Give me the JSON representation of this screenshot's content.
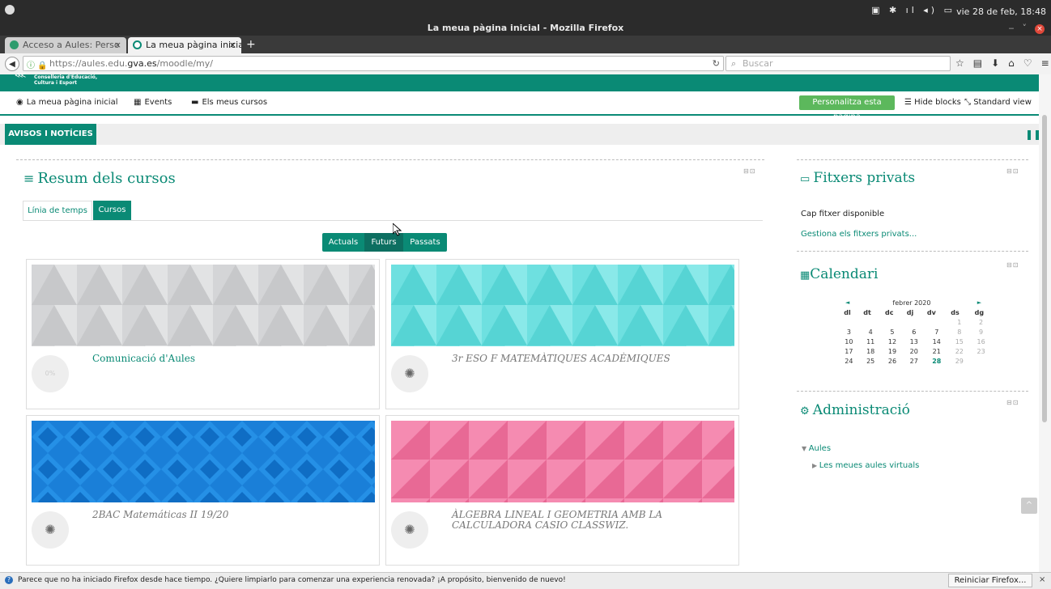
{
  "os": {
    "window_title": "La meua pàgina inicial - Mozilla Firefox",
    "clock": "vie 28 de feb, 18:48"
  },
  "browser": {
    "tabs": [
      {
        "label": "Acceso a Aules: Perso"
      },
      {
        "label": "La meua pàgina inicial"
      }
    ],
    "url_prefix": "https://aules.edu.",
    "url_domain": "gva.es",
    "url_path": "/moodle/my/",
    "search_placeholder": "Buscar"
  },
  "site": {
    "brand_line1": "Conselleria d'Educació,",
    "brand_line2": "Cultura i Esport"
  },
  "menu": {
    "home": "La meua pàgina inicial",
    "events": "Events",
    "courses": "Els meus cursos",
    "customise": "Personalitza esta pàgina",
    "hide_blocks": "Hide blocks",
    "standard_view": "Standard view"
  },
  "avisos": {
    "label": "AVISOS I NOTÍCIES"
  },
  "overview": {
    "title": "Resum dels cursos",
    "tabs": [
      "Línia de temps",
      "Cursos"
    ],
    "filters": [
      "Actuals",
      "Futurs",
      "Passats"
    ],
    "courses": [
      {
        "title": "Comunicació d'Aules",
        "progress_label": "0%",
        "banner_color": "#d4d5d7"
      },
      {
        "title": "3r ESO F MATEMÀTIQUES ACADÈMIQUES",
        "banner_color": "#6ee0e0"
      },
      {
        "title": "2BAC Matemáticas II 19/20",
        "banner_color": "#1a7fd8"
      },
      {
        "title": "ÀLGEBRA LINEAL I GEOMETRIA AMB LA CALCULADORA CASIO CLASSWIZ.",
        "banner_color": "#f27aa5"
      }
    ]
  },
  "private_files": {
    "title": "Fitxers privats",
    "empty": "Cap fitxer disponible",
    "manage_link": "Gestiona els fitxers privats..."
  },
  "calendar": {
    "title": "Calendari",
    "month": "febrer 2020",
    "prev": "◄",
    "next": "►",
    "day_headers": [
      "dl",
      "dt",
      "dc",
      "dj",
      "dv",
      "ds",
      "dg"
    ],
    "weeks": [
      [
        "",
        "",
        "",
        "",
        "",
        "1",
        "2"
      ],
      [
        "3",
        "4",
        "5",
        "6",
        "7",
        "8",
        "9"
      ],
      [
        "10",
        "11",
        "12",
        "13",
        "14",
        "15",
        "16"
      ],
      [
        "17",
        "18",
        "19",
        "20",
        "21",
        "22",
        "23"
      ],
      [
        "24",
        "25",
        "26",
        "27",
        "28",
        "29",
        ""
      ]
    ],
    "today": "28"
  },
  "admin": {
    "title": "Administració",
    "item_aules": "Aules",
    "item_virtual": "Les meues aules virtuals"
  },
  "notification": {
    "text": "Parece que no ha iniciado Firefox desde hace tiempo. ¿Quiere limpiarlo para comenzar una experiencia renovada? ¡A propósito, bienvenido de nuevo!",
    "button": "Reiniciar Firefox..."
  },
  "colors": {
    "accent": "#0a8a75",
    "success": "#5cb85c"
  }
}
